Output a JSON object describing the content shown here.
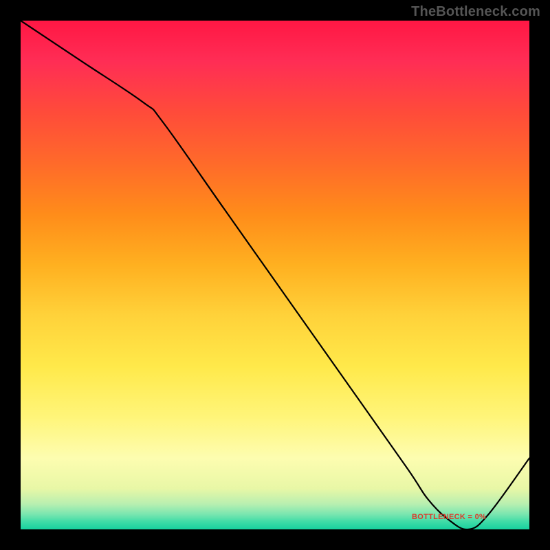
{
  "watermark": "TheBottleneck.com",
  "chart_data": {
    "type": "line",
    "title": "",
    "xlabel": "",
    "ylabel": "",
    "xlim": [
      0,
      100
    ],
    "ylim": [
      0,
      100
    ],
    "x": [
      0,
      12,
      24,
      28,
      40,
      52,
      64,
      76,
      80,
      84,
      88,
      92,
      100
    ],
    "values": [
      100,
      92,
      84,
      80,
      63,
      46,
      29,
      12,
      6,
      2,
      0,
      3,
      14
    ],
    "min_marker": {
      "x": 85,
      "label": "BOTTLENECK = 0%"
    }
  },
  "colors": {
    "curve": "#000000",
    "min_label": "#dc3a2a"
  },
  "min_label_text": "BOTTLENECK = 0%"
}
